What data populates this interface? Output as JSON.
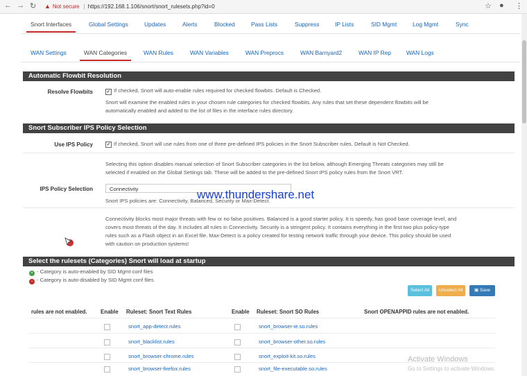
{
  "browser": {
    "security_label": "Not secure",
    "url": "https://192.168.1.106/snort/snort_rulesets.php?id=0"
  },
  "main_tabs": [
    "Snort Interfaces",
    "Global Settings",
    "Updates",
    "Alerts",
    "Blocked",
    "Pass Lists",
    "Suppress",
    "IP Lists",
    "SID Mgmt",
    "Log Mgmt",
    "Sync"
  ],
  "sub_tabs": [
    "WAN Settings",
    "WAN Categories",
    "WAN Rules",
    "WAN Variables",
    "WAN Preprocs",
    "WAN Barnyard2",
    "WAN IP Rep",
    "WAN Logs"
  ],
  "flowbit": {
    "title": "Automatic Flowbit Resolution",
    "label": "Resolve Flowbits",
    "check_text": "If checked, Snort will auto-enable rules required for checked flowbits. Default is Checked.",
    "help_1": "Snort will examine the enabled rules in your chosen rule categories for checked flowbits. Any rules that set these dependent flowbits will be",
    "help_2": "automatically enabled and added to the list of files in the interface rules directory."
  },
  "ips": {
    "title": "Snort Subscriber IPS Policy Selection",
    "use_label": "Use IPS Policy",
    "use_text": "If checked, Snort will use rules from one of three pre-defined IPS policies in the Snort Subscriber rules. Default is Not Checked.",
    "help_1": "Selecting this option disables manual selection of Snort Subscriber categories in the list below, although Emerging Threats categories may still be",
    "help_2": "selected if enabled on the Global Settings tab. These will be added to the pre-defined Snort IPS policy rules from the Snort VRT.",
    "policy_label": "IPS Policy Selection",
    "policy_value": "Connectivity",
    "policy_hint": "Snort IPS policies are: Connectivity, Balanced, Security or Max-Detect.",
    "desc_1": "Connectivity blocks most major threats with few or no false positives. Balanced is a good starter policy. It is speedy, has good base coverage level, and",
    "desc_2": "covers most threats of the day. It includes all rules in Connectivity. Security is a stringent policy. It contains everything in the first two plus policy-type",
    "desc_3": "rules such as a Flash object in an Excel file. Max-Detect is a policy created for testing network traffic through your device. This policy should be used",
    "desc_4": "with caution on production systems!"
  },
  "watermark": "www.thundershare.net",
  "rulesets": {
    "title": "Select the rulesets (Categories) Snort will load at startup",
    "legend_enabled": "- Category is auto-enabled by SID Mgmt conf files",
    "legend_disabled": "- Category is auto-disabled by SID Mgmt conf files",
    "btn_select_all": "Select All",
    "btn_unselect_all": "Unselect All",
    "btn_save": "Save",
    "col_not_enabled": "rules are not enabled.",
    "col_enable_1": "Enable",
    "col_text_rules": "Ruleset: Snort Text Rules",
    "col_enable_2": "Enable",
    "col_so_rules": "Ruleset: Snort SO Rules",
    "col_openappid": "Snort OPENAPPID rules are not enabled.",
    "rows": [
      {
        "text_rule": "snort_app-detect.rules",
        "so_rule": "snort_browser-ie.so.rules"
      },
      {
        "text_rule": "snort_blacklist.rules",
        "so_rule": "snort_browser-other.so.rules"
      },
      {
        "text_rule": "snort_browser-chrome.rules",
        "so_rule": "snort_exploit-kit.so.rules"
      },
      {
        "text_rule": "snort_browser-firefox.rules",
        "so_rule": "snort_file-executable.so.rules"
      }
    ]
  },
  "activation": {
    "title": "Activate Windows",
    "subtitle": "Go to Settings to activate Windows."
  },
  "colors": {
    "panel_header": "#424242",
    "tab_accent": "#c62828",
    "link": "#1565c0",
    "select_all_btn": "#5bc0de",
    "unselect_all_btn": "#f0ad4e",
    "save_btn": "#337ab7"
  }
}
